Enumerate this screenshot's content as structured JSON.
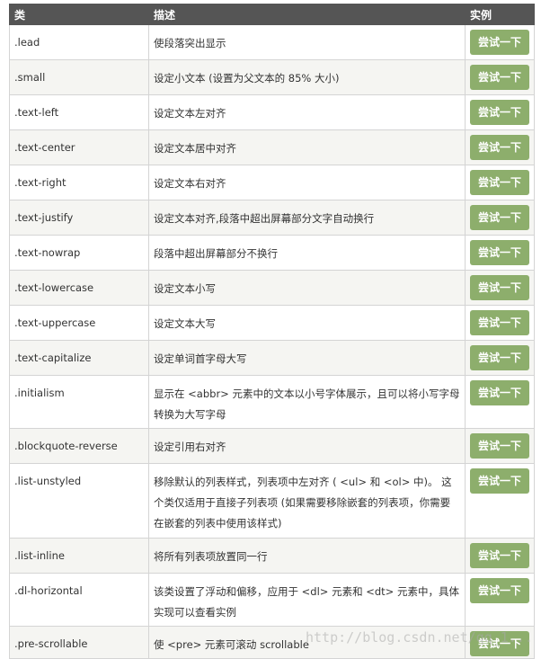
{
  "table": {
    "headers": [
      "类",
      "描述",
      "实例"
    ],
    "try_label": "尝试一下",
    "rows": [
      {
        "cls": ".lead",
        "desc": "使段落突出显示"
      },
      {
        "cls": ".small",
        "desc": "设定小文本 (设置为父文本的 85% 大小)"
      },
      {
        "cls": ".text-left",
        "desc": "设定文本左对齐"
      },
      {
        "cls": ".text-center",
        "desc": "设定文本居中对齐"
      },
      {
        "cls": ".text-right",
        "desc": "设定文本右对齐"
      },
      {
        "cls": ".text-justify",
        "desc": "设定文本对齐,段落中超出屏幕部分文字自动换行"
      },
      {
        "cls": ".text-nowrap",
        "desc": "段落中超出屏幕部分不换行"
      },
      {
        "cls": ".text-lowercase",
        "desc": "设定文本小写"
      },
      {
        "cls": ".text-uppercase",
        "desc": "设定文本大写"
      },
      {
        "cls": ".text-capitalize",
        "desc": "设定单词首字母大写"
      },
      {
        "cls": ".initialism",
        "desc": "显示在 <abbr> 元素中的文本以小号字体展示，且可以将小写字母转换为大写字母"
      },
      {
        "cls": ".blockquote-reverse",
        "desc": "设定引用右对齐"
      },
      {
        "cls": ".list-unstyled",
        "desc": "移除默认的列表样式，列表项中左对齐 ( <ul> 和 <ol> 中)。 这个类仅适用于直接子列表项 (如果需要移除嵌套的列表项，你需要在嵌套的列表中使用该样式)"
      },
      {
        "cls": ".list-inline",
        "desc": "将所有列表项放置同一行"
      },
      {
        "cls": ".dl-horizontal",
        "desc": "该类设置了浮动和偏移，应用于 <dl> 元素和 <dt> 元素中，具体实现可以查看实例"
      },
      {
        "cls": ".pre-scrollable",
        "desc": "使 <pre> 元素可滚动 scrollable"
      }
    ]
  },
  "watermark": "http://blog.csdn.net/qq_1..."
}
